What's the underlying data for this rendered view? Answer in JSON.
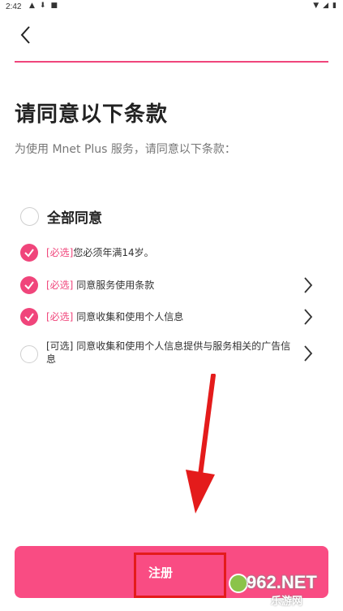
{
  "status_bar": {
    "time": "2:42"
  },
  "header": {
    "back_icon": "chevron-left-icon",
    "accent_color": "#f0457b"
  },
  "page": {
    "title": "请同意以下条款",
    "subtitle": "为使用 Mnet Plus 服务，请同意以下条款："
  },
  "agree_all": {
    "label": "全部同意",
    "checked": false
  },
  "terms": [
    {
      "tag": "[必选]",
      "text": "您必须年满14岁。",
      "checked": true,
      "has_arrow": false
    },
    {
      "tag": "[必选]",
      "text": " 同意服务使用条款",
      "checked": true,
      "has_arrow": true
    },
    {
      "tag": "[必选]",
      "text": " 同意收集和使用个人信息",
      "checked": true,
      "has_arrow": true
    },
    {
      "tag": "[可选]",
      "text": " 同意收集和使用个人信息提供与服务相关的广告信息",
      "checked": false,
      "has_arrow": true
    }
  ],
  "footer": {
    "register_label": "注册",
    "button_color": "#f94c83"
  },
  "watermark": {
    "number": "962.NET",
    "sub": "乐游网"
  }
}
